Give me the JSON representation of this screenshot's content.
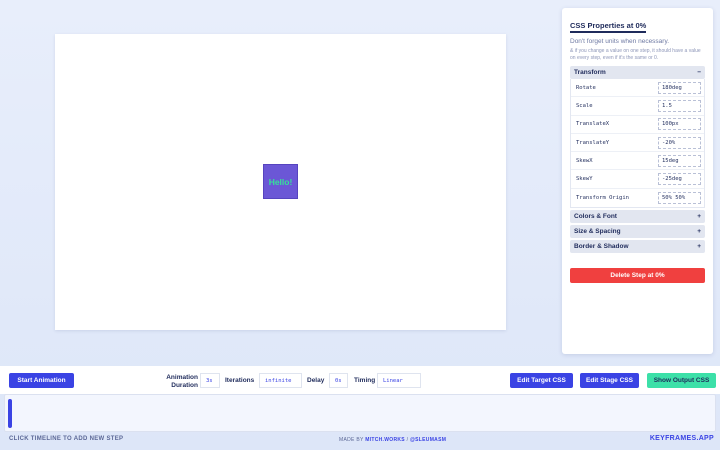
{
  "stage": {
    "target_text": "Hello!"
  },
  "panel": {
    "title": "CSS Properties at 0%",
    "subtitle": "Don't forget units when necessary.",
    "note": "& if you change a value on one step, it should have a value on every step, even if it's the same or 0.",
    "sections": {
      "transform": {
        "label": "Transform",
        "toggle": "−"
      },
      "colors_font": {
        "label": "Colors & Font",
        "toggle": "+"
      },
      "size_spacing": {
        "label": "Size & Spacing",
        "toggle": "+"
      },
      "border_shadow": {
        "label": "Border & Shadow",
        "toggle": "+"
      }
    },
    "properties": [
      {
        "label": "Rotate",
        "value": "180deg"
      },
      {
        "label": "Scale",
        "value": "1.5"
      },
      {
        "label": "TranslateX",
        "value": "100px"
      },
      {
        "label": "TranslateY",
        "value": "-20%"
      },
      {
        "label": "SkewX",
        "value": "15deg"
      },
      {
        "label": "SkewY",
        "value": "-25deg"
      },
      {
        "label": "Transform Origin",
        "value": "50% 50%"
      }
    ],
    "delete_label": "Delete Step at 0%"
  },
  "toolbar": {
    "start_label": "Start Animation",
    "duration_label_1": "Animation",
    "duration_label_2": "Duration",
    "duration_value": "3s",
    "iterations_label": "Iterations",
    "iterations_value": "infinite",
    "delay_label": "Delay",
    "delay_value": "0s",
    "timing_label": "Timing",
    "timing_value": "Linear",
    "edit_target_label": "Edit Target CSS",
    "edit_stage_label": "Edit Stage CSS",
    "show_output_label": "Show Output CSS"
  },
  "footer": {
    "hint": "CLICK TIMELINE TO ADD NEW STEP",
    "made_by_prefix": "MADE BY",
    "made_by_link1": "MITCH.WORKS",
    "made_by_sep": " / ",
    "made_by_link2": "@SLEUMASM",
    "site": "KEYFRAMES.APP"
  },
  "colors": {
    "accent": "#3a43e4",
    "danger": "#f0403f",
    "success": "#3ce0a8",
    "target": "#6b57d6"
  }
}
